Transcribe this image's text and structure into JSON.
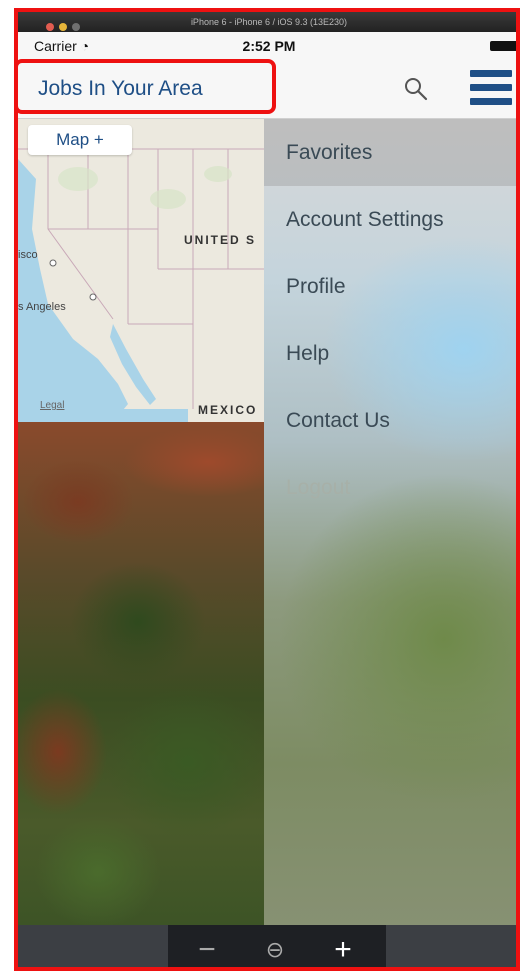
{
  "simulator": {
    "title": "iPhone 6 - iPhone 6 / iOS 9.3 (13E230)"
  },
  "status_bar": {
    "carrier": "Carrier",
    "time": "2:52 PM"
  },
  "nav": {
    "title": "Jobs In Your Area",
    "search_icon": "search-icon",
    "menu_icon": "hamburger-menu-icon"
  },
  "map": {
    "button_label": "Map +",
    "labels": {
      "country_us": "UNITED S",
      "city_sf": "isco",
      "city_la": "s Angeles",
      "country_mx": "MEXICO"
    },
    "legal": "Legal"
  },
  "menu": {
    "items": [
      {
        "label": "Favorites"
      },
      {
        "label": "Account Settings"
      },
      {
        "label": "Profile"
      },
      {
        "label": "Help"
      },
      {
        "label": "Contact Us"
      },
      {
        "label": "Logout"
      }
    ]
  },
  "toolbar": {
    "zoom_out": "−",
    "zoom_reset": "⊖",
    "zoom_in": "+"
  },
  "colors": {
    "accent": "#1f4f86",
    "annotation": "#ee1111"
  }
}
